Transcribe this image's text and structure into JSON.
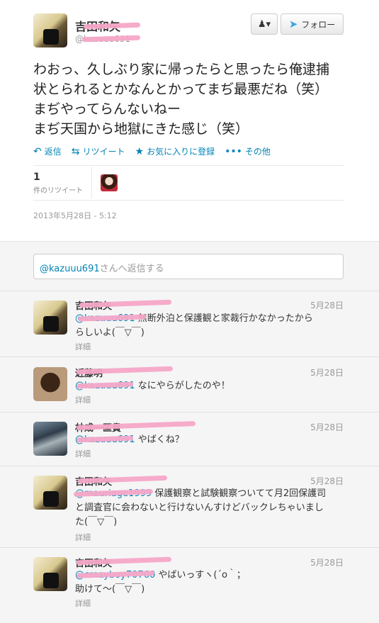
{
  "tweet": {
    "name": "吉田和矢",
    "handle": "@kazuuu691",
    "follow_label": "フォロー",
    "body_lines": [
      "わおっ、久しぶり家に帰ったらと思ったら俺逮捕",
      "状とられるとかなんとかってまぢ最悪だね（笑）",
      "まぢやってらんないねー",
      "まぢ天国から地獄にきた感じ（笑）"
    ],
    "actions": {
      "reply": "返信",
      "retweet": "リツイート",
      "favorite": "お気に入りに登録",
      "more": "その他"
    },
    "stats": {
      "count": "1",
      "label": "件のリツイート"
    },
    "timestamp": "2013年5月28日 - 5:12"
  },
  "reply_box": {
    "mention": "@kazuuu691",
    "suffix": "さんへ返信する"
  },
  "replies": [
    {
      "name": "吉田和矢",
      "date": "5月28日",
      "mention": "@kazuuu691",
      "lines": [
        "無断外泊と保護観と家裁行かなかったから",
        "らしいよ(￣▽￣)"
      ],
      "detail": "詳細"
    },
    {
      "name": "近藤明",
      "date": "5月28日",
      "mention": "@kazuuu691",
      "lines": [
        "なにやらがしたのや！"
      ],
      "detail": "詳細"
    },
    {
      "name": "林成一匡貴",
      "date": "5月28日",
      "mention": "@kazuuu691",
      "lines": [
        "やばくね？"
      ],
      "detail": "詳細"
    },
    {
      "name": "吉田和矢",
      "date": "5月28日",
      "mention": "@mauriage1999",
      "lines": [
        "保護観察と試験観察ついてて月2回保護司",
        "と調査官に会わないと行けないんすけどバックレちゃいまし",
        "た(￣▽￣)"
      ],
      "detail": "詳細"
    },
    {
      "name": "吉田和矢",
      "date": "5月28日",
      "mention": "@crazyboy70760",
      "lines": [
        "やばいっすヽ(´o｀；",
        "助けて～(￣▽￣)"
      ],
      "detail": "詳細"
    }
  ]
}
